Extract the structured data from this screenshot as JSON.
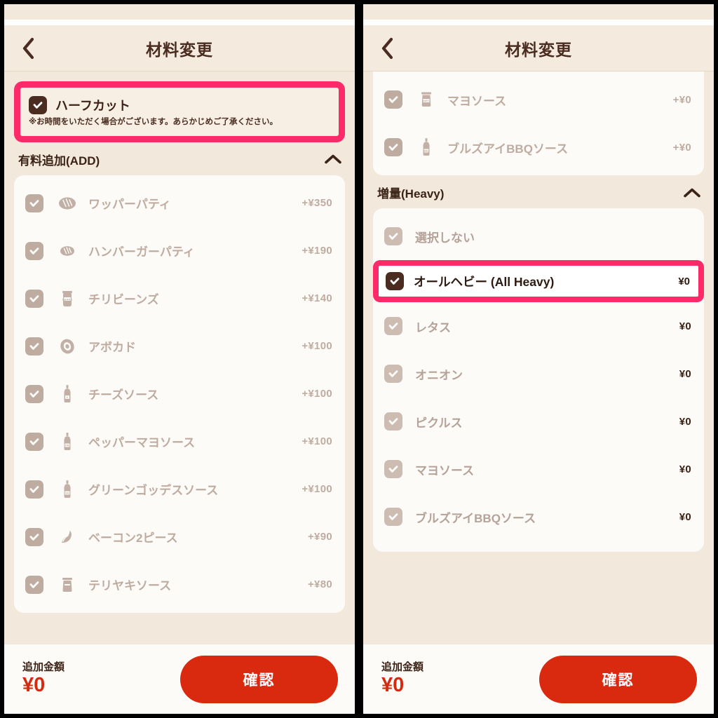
{
  "app": {
    "accent_pink": "#fc2a68",
    "accent_red": "#d9290e",
    "page_bg": "#f2e8dc",
    "card_bg": "#fdfbf7",
    "text_dark": "#3c2318",
    "text_muted": "#bfaca1"
  },
  "left_panel": {
    "header": {
      "title": "材料変更",
      "back_icon": "chevron-left-icon"
    },
    "highlight_option": {
      "label": "ハーフカット",
      "note": "※お時間をいただく場合がございます。あらかじめご了承ください。",
      "checked": true,
      "highlighted": true
    },
    "section": {
      "title": "有料追加(ADD)",
      "collapse_icon": "chevron-up-icon",
      "expanded": true
    },
    "items": [
      {
        "label": "ワッパーパティ",
        "price": "+¥350",
        "icon": "patty-icon",
        "checked": true
      },
      {
        "label": "ハンバーガーパティ",
        "price": "+¥190",
        "icon": "patty-icon",
        "checked": true
      },
      {
        "label": "チリビーンズ",
        "price": "+¥140",
        "icon": "beans-can-icon",
        "checked": true
      },
      {
        "label": "アボカド",
        "price": "+¥100",
        "icon": "avocado-icon",
        "checked": true
      },
      {
        "label": "チーズソース",
        "price": "+¥100",
        "icon": "cheese-bottle-icon",
        "checked": true
      },
      {
        "label": "ペッパーマヨソース",
        "price": "+¥100",
        "icon": "pepper-mayo-icon",
        "checked": true
      },
      {
        "label": "グリーンゴッデスソース",
        "price": "+¥100",
        "icon": "green-goddess-icon",
        "checked": true
      },
      {
        "label": "ベーコン2ピース",
        "price": "+¥90",
        "icon": "bacon-icon",
        "checked": true
      },
      {
        "label": "テリヤキソース",
        "price": "+¥80",
        "icon": "teriyaki-jar-icon",
        "checked": true
      }
    ],
    "footer": {
      "amount_label": "追加金額",
      "amount_value": "¥0",
      "confirm_label": "確認"
    }
  },
  "right_panel": {
    "header": {
      "title": "材料変更",
      "back_icon": "chevron-left-icon"
    },
    "top_items": [
      {
        "label": "マヨソース",
        "price": "+¥0",
        "icon": "mayo-jar-icon",
        "checked": true
      },
      {
        "label": "ブルズアイBBQソース",
        "price": "+¥0",
        "icon": "bbq-bottle-icon",
        "checked": true
      }
    ],
    "section": {
      "title": "増量(Heavy)",
      "collapse_icon": "chevron-up-icon",
      "expanded": true
    },
    "none_option": {
      "label": "選択しない",
      "price": "",
      "checked": true
    },
    "highlight_option": {
      "label": "オールヘビー (All Heavy)",
      "price": "¥0",
      "checked": true,
      "highlighted": true
    },
    "items": [
      {
        "label": "レタス",
        "price": "¥0",
        "checked": true
      },
      {
        "label": "オニオン",
        "price": "¥0",
        "checked": true
      },
      {
        "label": "ピクルス",
        "price": "¥0",
        "checked": true
      },
      {
        "label": "マヨソース",
        "price": "¥0",
        "checked": true
      },
      {
        "label": "ブルズアイBBQソース",
        "price": "¥0",
        "checked": true
      }
    ],
    "footer": {
      "amount_label": "追加金額",
      "amount_value": "¥0",
      "confirm_label": "確認"
    }
  }
}
